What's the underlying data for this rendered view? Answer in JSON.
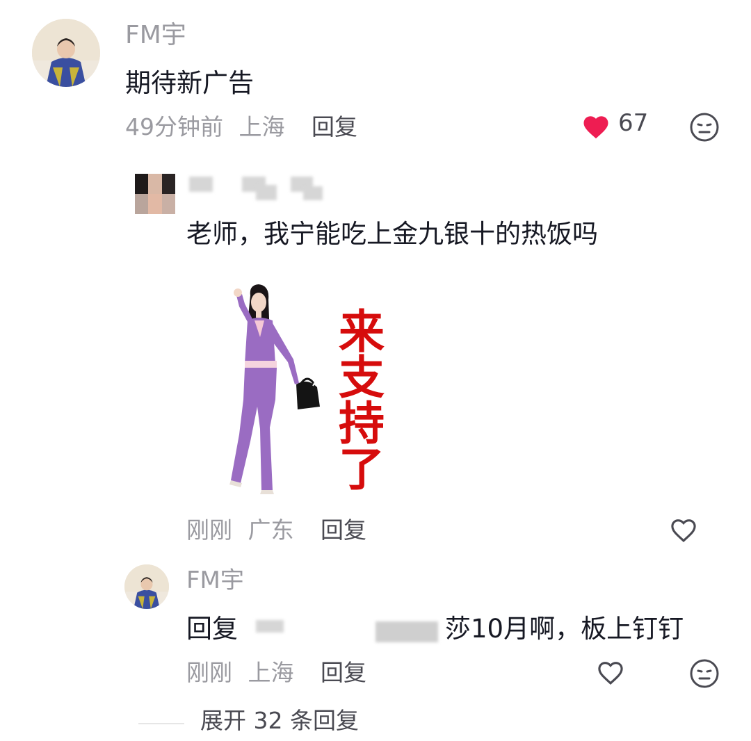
{
  "comment": {
    "username": "FM宇",
    "text": "期待新广告",
    "time": "49分钟前",
    "location": "上海",
    "reply_label": "回复",
    "likes": "67"
  },
  "reply1": {
    "text": "老师，我宁能吃上金九银十的热饭吗",
    "sticker_caption": "来支持了",
    "time": "刚刚",
    "location": "广东",
    "reply_label": "回复"
  },
  "reply2": {
    "username": "FM宇",
    "text_prefix": "回复",
    "text_suffix": "莎10月啊，板上钉钉",
    "time": "刚刚",
    "location": "上海",
    "reply_label": "回复"
  },
  "expand": {
    "label": "展开 32 条回复"
  },
  "colors": {
    "heart": "#ee1d52",
    "sticker_text": "#d60c0c"
  }
}
